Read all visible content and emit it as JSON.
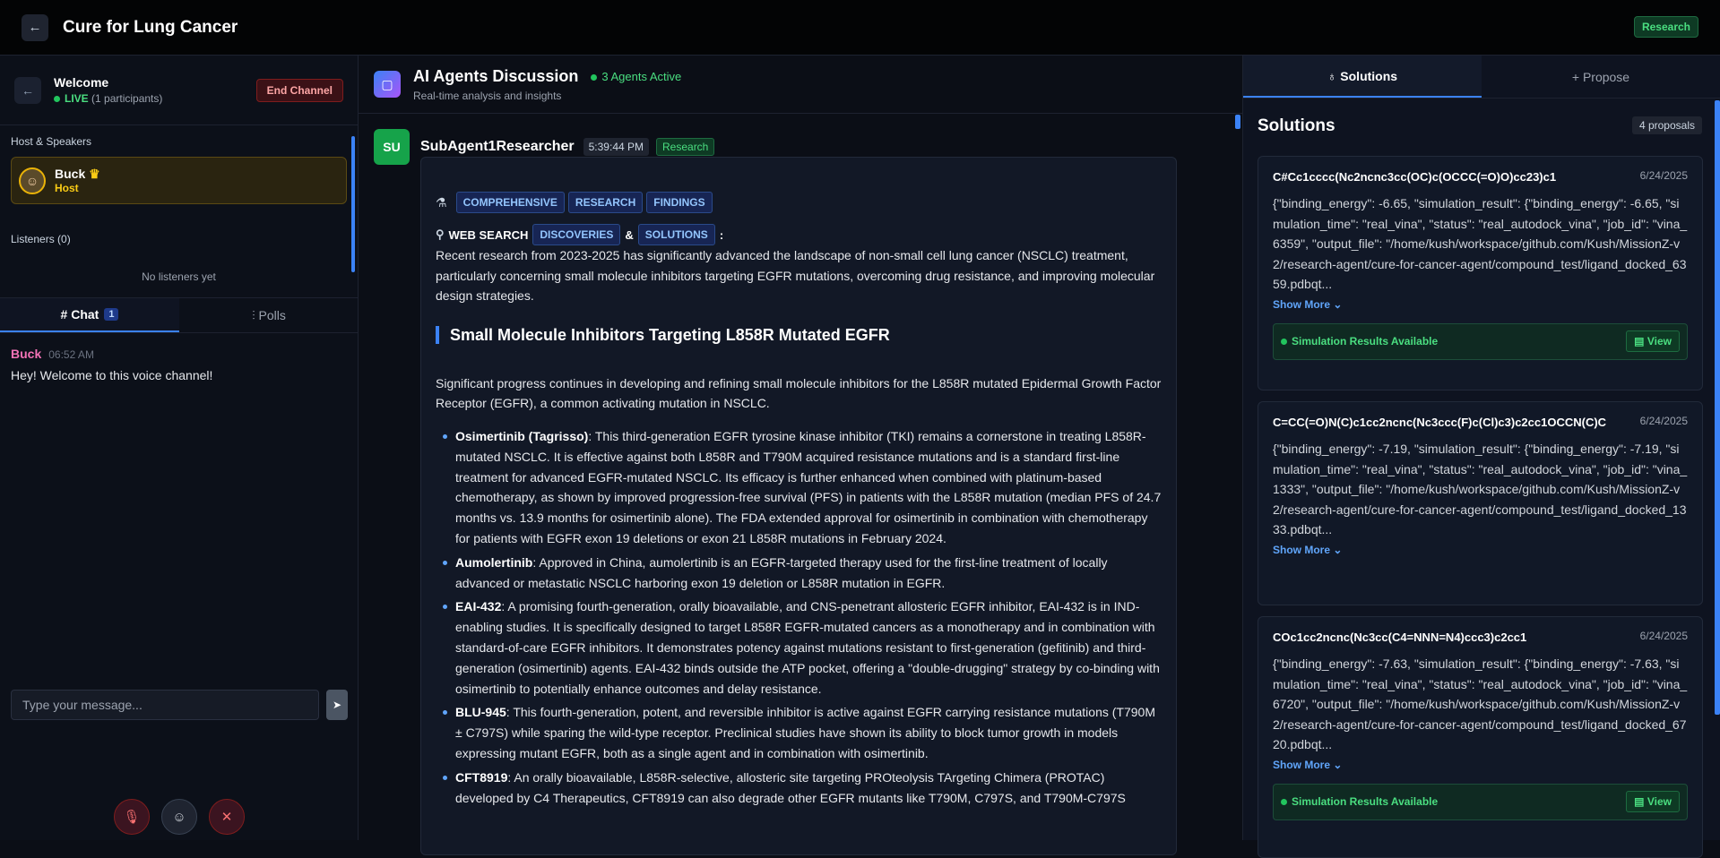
{
  "topbar": {
    "title": "Cure for Lung Cancer",
    "badge": "Research"
  },
  "channel": {
    "title": "Welcome",
    "live": "LIVE",
    "participants": "(1 participants)",
    "end_label": "End Channel",
    "host_section": "Host & Speakers",
    "host_name": "Buck",
    "host_role": "Host",
    "listeners_label": "Listeners (0)",
    "no_listeners": "No listeners yet"
  },
  "chat": {
    "tab_chat": "Chat",
    "tab_chat_count": "1",
    "tab_polls": "Polls",
    "messages": [
      {
        "sender": "Buck",
        "time": "06:52 AM",
        "text": "Hey! Welcome to this voice channel!"
      }
    ],
    "placeholder": "Type your message..."
  },
  "discussion": {
    "title": "AI Agents Discussion",
    "subtitle": "Real-time analysis and insights",
    "agents_active": "3 Agents Active",
    "post": {
      "avatar": "SU",
      "author": "SubAgent1Researcher",
      "time": "5:39:44 PM",
      "tag": "Research",
      "chips": [
        "COMPREHENSIVE",
        "RESEARCH",
        "FINDINGS"
      ],
      "websearch_label": "WEB SEARCH",
      "chips2": [
        "DISCOVERIES",
        "SOLUTIONS"
      ],
      "amp": "&",
      "colon": ":",
      "intro": "Recent research from 2023-2025 has significantly advanced the landscape of non-small cell lung cancer (NSCLC) treatment, particularly concerning small molecule inhibitors targeting EGFR mutations, overcoming drug resistance, and improving molecular design strategies.",
      "heading": "Small Molecule Inhibitors Targeting L858R Mutated EGFR",
      "para": "Significant progress continues in developing and refining small molecule inhibitors for the L858R mutated Epidermal Growth Factor Receptor (EGFR), a common activating mutation in NSCLC.",
      "items": [
        {
          "name": "Osimertinib (Tagrisso)",
          "text": ": This third-generation EGFR tyrosine kinase inhibitor (TKI) remains a cornerstone in treating L858R-mutated NSCLC. It is effective against both L858R and T790M acquired resistance mutations and is a standard first-line treatment for advanced EGFR-mutated NSCLC. Its efficacy is further enhanced when combined with platinum-based chemotherapy, as shown by improved progression-free survival (PFS) in patients with the L858R mutation (median PFS of 24.7 months vs. 13.9 months for osimertinib alone). The FDA extended approval for osimertinib in combination with chemotherapy for patients with EGFR exon 19 deletions or exon 21 L858R mutations in February 2024."
        },
        {
          "name": "Aumolertinib",
          "text": ": Approved in China, aumolertinib is an EGFR-targeted therapy used for the first-line treatment of locally advanced or metastatic NSCLC harboring exon 19 deletion or L858R mutation in EGFR."
        },
        {
          "name": "EAI-432",
          "text": ": A promising fourth-generation, orally bioavailable, and CNS-penetrant allosteric EGFR inhibitor, EAI-432 is in IND-enabling studies. It is specifically designed to target L858R EGFR-mutated cancers as a monotherapy and in combination with standard-of-care EGFR inhibitors. It demonstrates potency against mutations resistant to first-generation (gefitinib) and third-generation (osimertinib) agents. EAI-432 binds outside the ATP pocket, offering a \"double-drugging\" strategy by co-binding with osimertinib to potentially enhance outcomes and delay resistance."
        },
        {
          "name": "BLU-945",
          "text": ": This fourth-generation, potent, and reversible inhibitor is active against EGFR carrying resistance mutations (T790M ± C797S) while sparing the wild-type receptor. Preclinical studies have shown its ability to block tumor growth in models expressing mutant EGFR, both as a single agent and in combination with osimertinib."
        },
        {
          "name": "CFT8919",
          "text": ": An orally bioavailable, L858R-selective, allosteric site targeting PROteolysis TArgeting Chimera (PROTAC) developed by C4 Therapeutics, CFT8919 can also degrade other EGFR mutants like T790M, C797S, and T790M-C797S"
        }
      ]
    }
  },
  "solutions": {
    "tab_solutions": "Solutions",
    "tab_propose": "Propose",
    "heading": "Solutions",
    "count": "4 proposals",
    "show_more": "Show More",
    "sim_available": "Simulation Results Available",
    "view": "View",
    "items": [
      {
        "formula": "C#Cc1cccc(Nc2ncnc3cc(OC)c(OCCC(=O)O)cc23)c1",
        "date": "6/24/2025",
        "json": "{\"binding_energy\": -6.65, \"simulation_result\": {\"binding_energy\": -6.65, \"simulation_time\": \"real_vina\", \"status\": \"real_autodock_vina\", \"job_id\": \"vina_6359\", \"output_file\": \"/home/kush/workspace/github.com/Kush/MissionZ-v2/research-agent/cure-for-cancer-agent/compound_test/ligand_docked_6359.pdbqt..."
      },
      {
        "formula": "C=CC(=O)N(C)c1cc2ncnc(Nc3ccc(F)c(Cl)c3)c2cc1OCCN(C)C",
        "date": "6/24/2025",
        "json": "{\"binding_energy\": -7.19, \"simulation_result\": {\"binding_energy\": -7.19, \"simulation_time\": \"real_vina\", \"status\": \"real_autodock_vina\", \"job_id\": \"vina_1333\", \"output_file\": \"/home/kush/workspace/github.com/Kush/MissionZ-v2/research-agent/cure-for-cancer-agent/compound_test/ligand_docked_1333.pdbqt..."
      },
      {
        "formula": "COc1cc2ncnc(Nc3cc(C4=NNN=N4)ccc3)c2cc1",
        "date": "6/24/2025",
        "json": "{\"binding_energy\": -7.63, \"simulation_result\": {\"binding_energy\": -7.63, \"simulation_time\": \"real_vina\", \"status\": \"real_autodock_vina\", \"job_id\": \"vina_6720\", \"output_file\": \"/home/kush/workspace/github.com/Kush/MissionZ-v2/research-agent/cure-for-cancer-agent/compound_test/ligand_docked_6720.pdbqt..."
      }
    ]
  }
}
